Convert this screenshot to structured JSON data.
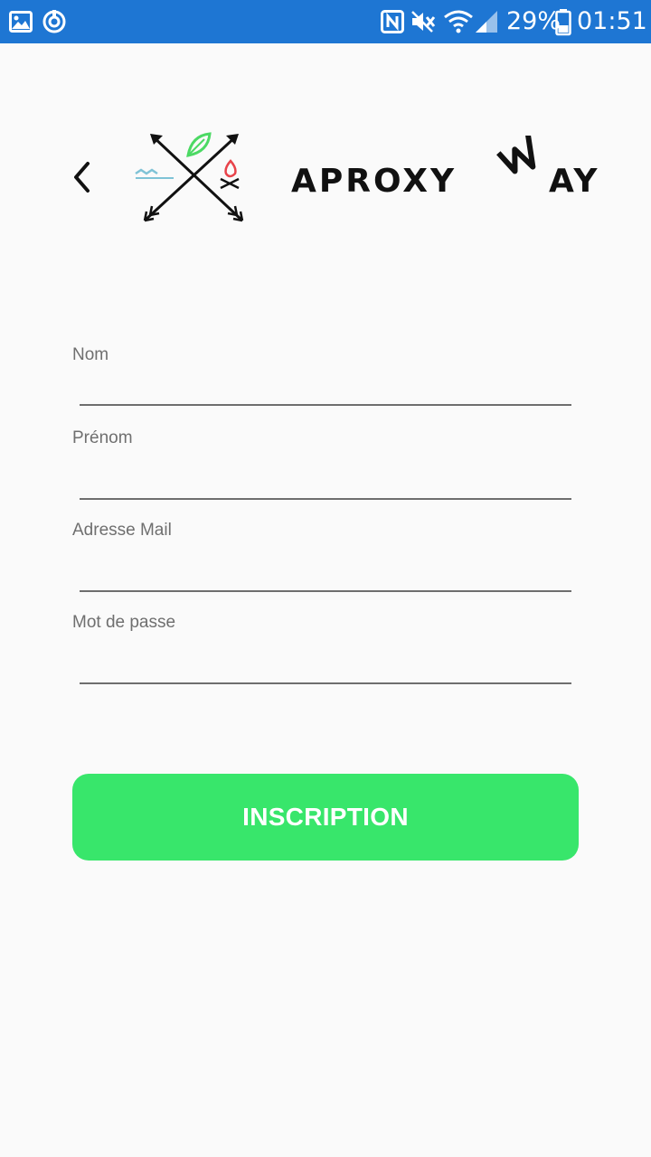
{
  "status_bar": {
    "battery_percent": "29%",
    "time": "01:51",
    "icons": [
      "gallery-icon",
      "sync-icon",
      "nfc-icon",
      "mute-icon",
      "wifi-icon",
      "signal-icon",
      "battery-icon"
    ]
  },
  "header": {
    "back_icon": "chevron-left-icon",
    "logo_text_left": "APROXY",
    "logo_text_w": "W",
    "logo_text_right": "AY"
  },
  "form": {
    "fields": [
      {
        "label": "Nom",
        "value": "",
        "type": "text"
      },
      {
        "label": "Prénom",
        "value": "",
        "type": "text"
      },
      {
        "label": "Adresse Mail",
        "value": "",
        "type": "email"
      },
      {
        "label": "Mot de passe",
        "value": "",
        "type": "password"
      }
    ],
    "submit_label": "INSCRIPTION"
  },
  "colors": {
    "status_bar": "#1e76d3",
    "background": "#fafafa",
    "button": "#38e66b",
    "leaf": "#4cd964",
    "flame": "#e8434a",
    "water": "#7fc3d6"
  }
}
